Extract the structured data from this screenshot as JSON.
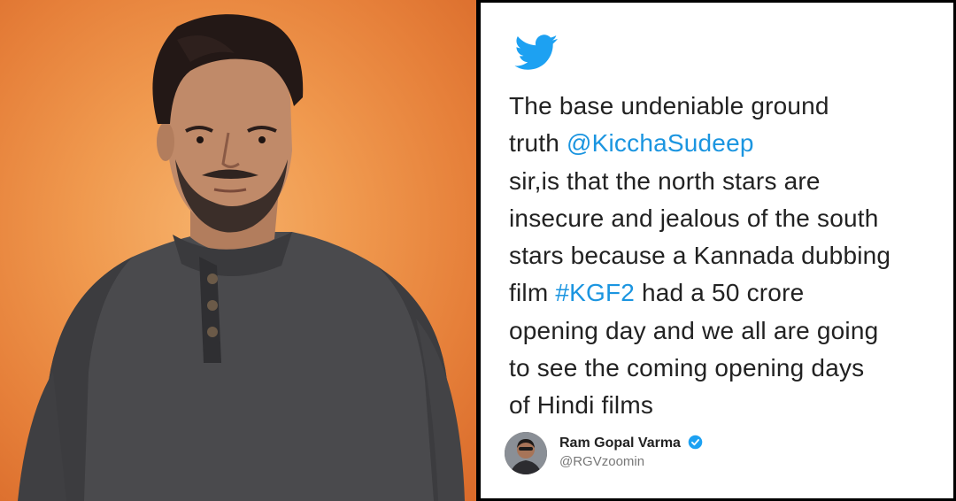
{
  "photo": {
    "description_icon": "portrait-photo",
    "background_color": "#f09a4f",
    "shirt_color": "#4a4a4c"
  },
  "tweet": {
    "icon": "twitter-bird-icon",
    "brand_color": "#1da1f2",
    "link_color": "#1b95e0",
    "lines": [
      [
        {
          "t": "The base undeniable ground"
        }
      ],
      [
        {
          "t": "truth "
        },
        {
          "t": "@KicchaSudeep",
          "link": true
        }
      ],
      [
        {
          "t": "sir,is that the north stars are"
        }
      ],
      [
        {
          "t": "insecure and jealous of the south"
        }
      ],
      [
        {
          "t": "stars because a Kannada dubbing"
        }
      ],
      [
        {
          "t": "film "
        },
        {
          "t": "#KGF2",
          "link": true
        },
        {
          "t": " had a 50 crore"
        }
      ],
      [
        {
          "t": "opening day and we all are going"
        }
      ],
      [
        {
          "t": "to see the coming opening days"
        }
      ],
      [
        {
          "t": "of Hindi films"
        }
      ]
    ],
    "author": {
      "name": "Ram Gopal Varma",
      "handle": "@RGVzoomin",
      "verified_icon": "verified-badge-icon"
    }
  }
}
